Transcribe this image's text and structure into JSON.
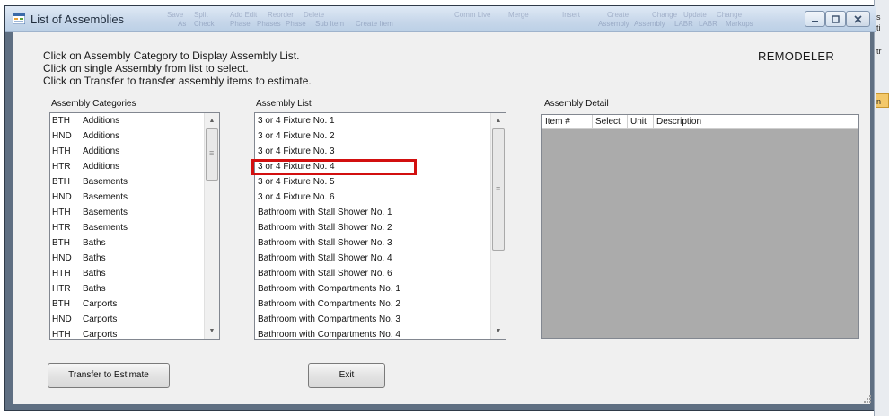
{
  "window": {
    "title": "List of Assemblies",
    "ghost_toolbar_row1": [
      "Save",
      "Split",
      "Add Edit",
      "Reorder",
      "Delete",
      "Comm Live",
      "Merge",
      "Insert",
      "Create",
      "Change",
      "Update",
      "Change"
    ],
    "ghost_toolbar_row2": [
      "As",
      "Check",
      "Phase",
      "Phases",
      "Phase",
      "Sub Item",
      "Create Item",
      "Assembly",
      "Assembly",
      "LABR",
      "LABR",
      "Markups"
    ]
  },
  "instructions": [
    "Click on Assembly Category to Display Assembly List.",
    "Click on single Assembly from list to select.",
    "Click on Transfer to transfer assembly items to estimate."
  ],
  "brand": "REMODELER",
  "labels": {
    "categories": "Assembly Categories",
    "list": "Assembly List",
    "detail": "Assembly Detail"
  },
  "categories": [
    {
      "code": "BTH",
      "name": "Additions"
    },
    {
      "code": "HND",
      "name": "Additions"
    },
    {
      "code": "HTH",
      "name": "Additions"
    },
    {
      "code": "HTR",
      "name": "Additions"
    },
    {
      "code": "BTH",
      "name": "Basements"
    },
    {
      "code": "HND",
      "name": "Basements"
    },
    {
      "code": "HTH",
      "name": "Basements"
    },
    {
      "code": "HTR",
      "name": "Basements"
    },
    {
      "code": "BTH",
      "name": "Baths"
    },
    {
      "code": "HND",
      "name": "Baths"
    },
    {
      "code": "HTH",
      "name": "Baths"
    },
    {
      "code": "HTR",
      "name": "Baths"
    },
    {
      "code": "BTH",
      "name": "Carports"
    },
    {
      "code": "HND",
      "name": "Carports"
    },
    {
      "code": "HTH",
      "name": "Carports"
    }
  ],
  "assemblies": [
    "3 or 4 Fixture No. 1",
    "3 or 4 Fixture No. 2",
    "3 or 4 Fixture No. 3",
    "3 or 4 Fixture No. 4",
    "3 or 4 Fixture No. 5",
    "3 or 4 Fixture No. 6",
    "Bathroom with Stall Shower No. 1",
    "Bathroom with Stall Shower No. 2",
    "Bathroom with Stall Shower No. 3",
    "Bathroom with Stall Shower No. 4",
    "Bathroom with Stall Shower No. 6",
    "Bathroom with Compartments No. 1",
    "Bathroom with Compartments No. 2",
    "Bathroom with Compartments No. 3",
    "Bathroom with Compartments No. 4"
  ],
  "highlighted_assembly": "3 or 4 Fixture No. 4",
  "detail_columns": [
    "Item #",
    "Select",
    "Unit",
    "Description"
  ],
  "buttons": {
    "transfer": "Transfer to Estimate",
    "exit": "Exit"
  },
  "colors": {
    "highlight_border": "#d20f0f",
    "detail_background": "#ababab",
    "titlebar": "#c7d7ea"
  }
}
